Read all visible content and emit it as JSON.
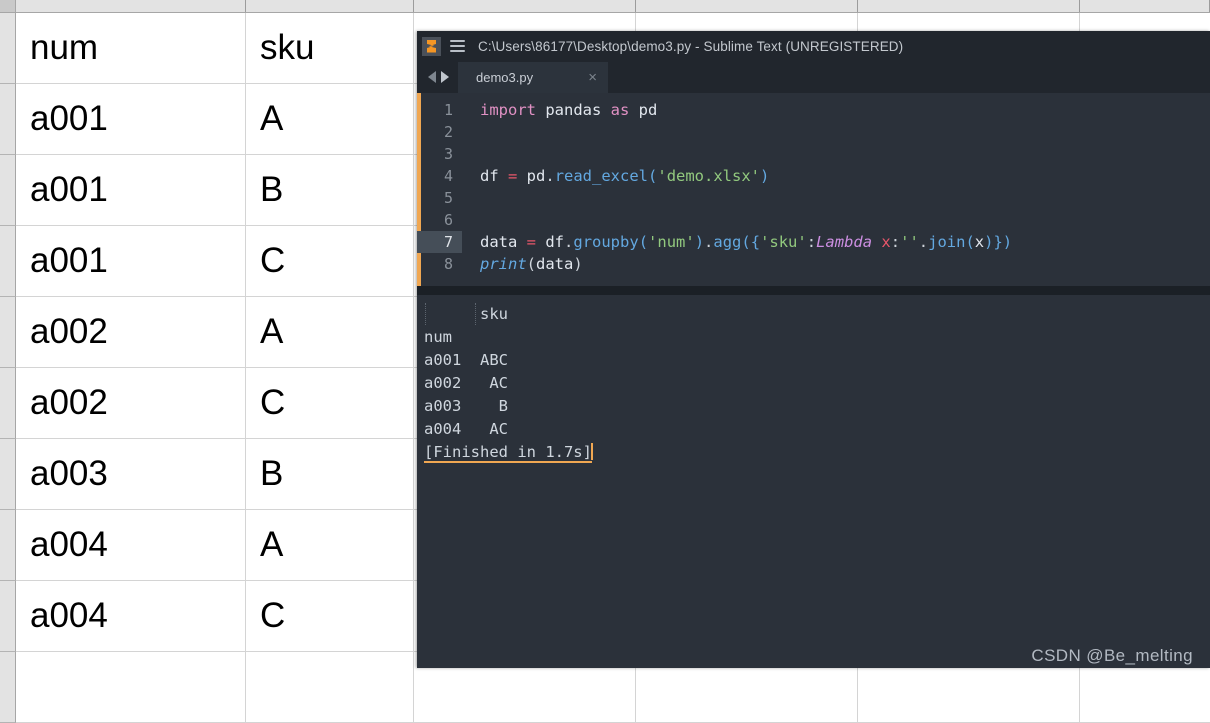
{
  "excel": {
    "columns": [
      {
        "key": "num",
        "width_class": "c-num"
      },
      {
        "key": "sku",
        "width_class": "c-sku"
      },
      {
        "key": "x1",
        "width_class": "c-x1"
      },
      {
        "key": "x2",
        "width_class": "c-x2"
      },
      {
        "key": "x3",
        "width_class": "c-x3"
      },
      {
        "key": "x4",
        "width_class": "c-x4"
      }
    ],
    "rows": [
      {
        "num": "num",
        "sku": "sku"
      },
      {
        "num": "a001",
        "sku": "A"
      },
      {
        "num": "a001",
        "sku": "B"
      },
      {
        "num": "a001",
        "sku": "C"
      },
      {
        "num": "a002",
        "sku": "A"
      },
      {
        "num": "a002",
        "sku": "C"
      },
      {
        "num": "a003",
        "sku": "B"
      },
      {
        "num": "a004",
        "sku": "A"
      },
      {
        "num": "a004",
        "sku": "C"
      },
      {
        "num": "",
        "sku": ""
      }
    ]
  },
  "sublime": {
    "titlebar": {
      "logo_icon": "sublime-logo-icon",
      "menu_icon": "hamburger-menu-icon",
      "title": "C:\\Users\\86177\\Desktop\\demo3.py - Sublime Text (UNREGISTERED)"
    },
    "tabbar": {
      "prev_icon": "arrow-left-icon",
      "next_icon": "arrow-right-icon",
      "tabs": [
        {
          "label": "demo3.py",
          "close_label": "×",
          "active": true
        }
      ]
    },
    "editor": {
      "active_line": 7,
      "lines": [
        {
          "n": "1",
          "text": "import pandas as pd"
        },
        {
          "n": "2",
          "text": ""
        },
        {
          "n": "3",
          "text": ""
        },
        {
          "n": "4",
          "text": "df = pd.read_excel('demo.xlsx')"
        },
        {
          "n": "5",
          "text": ""
        },
        {
          "n": "6",
          "text": ""
        },
        {
          "n": "7",
          "text": "data = df.groupby('num').agg({'sku':Lambda x:''.join(x)})"
        },
        {
          "n": "8",
          "text": "print(data)"
        }
      ]
    },
    "console": {
      "lines": [
        "      sku",
        "num",
        "a001  ABC",
        "a002   AC",
        "a003    B",
        "a004   AC"
      ],
      "status_line": "[Finished in 1.7s]"
    },
    "watermark": "CSDN @Be_melting"
  },
  "colors": {
    "sublime_bg": "#2b313a",
    "chrome_bg": "#21262d",
    "accent_orange": "#f0a752",
    "keyword_pink": "#e191c4",
    "function_blue": "#63a8e0",
    "string_green": "#92c97e",
    "operator_red": "#e8566a",
    "lambda_purple": "#cb8ee0",
    "excel_header_gray": "#e3e3e3"
  }
}
